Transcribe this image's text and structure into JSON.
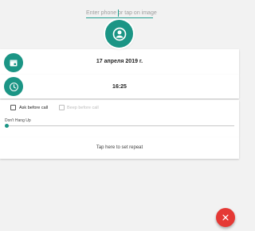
{
  "phone": {
    "placeholder": "Enter phone or tap on image",
    "value": ""
  },
  "contact": {
    "icon": "person-icon"
  },
  "date": {
    "icon": "calendar-icon",
    "text": "17 апреля 2019 г."
  },
  "time": {
    "icon": "clock-icon",
    "text": "16:25"
  },
  "options": {
    "ask_before_call": {
      "label": "Ask before call",
      "checked": false
    },
    "beep_before_call": {
      "label": "Beep before call",
      "checked": false,
      "enabled": false
    }
  },
  "hangup": {
    "label": "Don't Hang Up",
    "level": 0
  },
  "repeat": {
    "label": "Tap here to set repeat"
  },
  "fab": {
    "icon": "close-icon"
  },
  "colors": {
    "accent": "#1b9585",
    "danger": "#e53935"
  }
}
